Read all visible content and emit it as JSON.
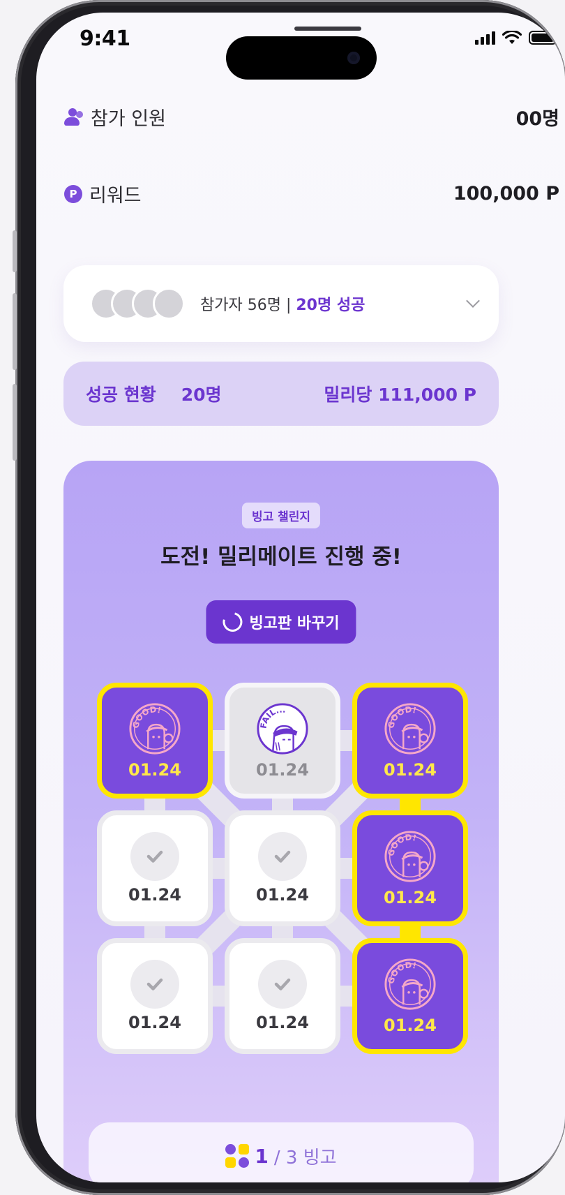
{
  "status": {
    "time": "9:41"
  },
  "info": {
    "participants_label": "참가 인원",
    "participants_value": "00명",
    "reward_label": "리워드",
    "reward_value": "100,000 P",
    "reward_icon_text": "P"
  },
  "participants_card": {
    "text": "참가자 56명 | ",
    "success_text": "20명 성공"
  },
  "success_bar": {
    "label": "성공 현황",
    "count": "20명",
    "per_person": "밀리당 111,000 P"
  },
  "bingo": {
    "tag": "빙고 챌린지",
    "title": "도전! 밀리메이트 진행 중!",
    "change_button": "빙고판 바꾸기",
    "cells": [
      {
        "state": "good",
        "date": "01.24",
        "stamp": "GOOD!"
      },
      {
        "state": "fail",
        "date": "01.24",
        "stamp": "FAIL..."
      },
      {
        "state": "good",
        "date": "01.24",
        "stamp": "GOOD!"
      },
      {
        "state": "empty",
        "date": "01.24"
      },
      {
        "state": "empty",
        "date": "01.24"
      },
      {
        "state": "good",
        "date": "01.24",
        "stamp": "GOOD!"
      },
      {
        "state": "empty",
        "date": "01.24"
      },
      {
        "state": "empty",
        "date": "01.24"
      },
      {
        "state": "good",
        "date": "01.24",
        "stamp": "GOOD!"
      }
    ],
    "counter_current": "1",
    "counter_rest": " / 3 빙고"
  },
  "colors": {
    "accent": "#6b35cf",
    "success_border": "#ffe600",
    "good_cell": "#7a4bdd"
  }
}
